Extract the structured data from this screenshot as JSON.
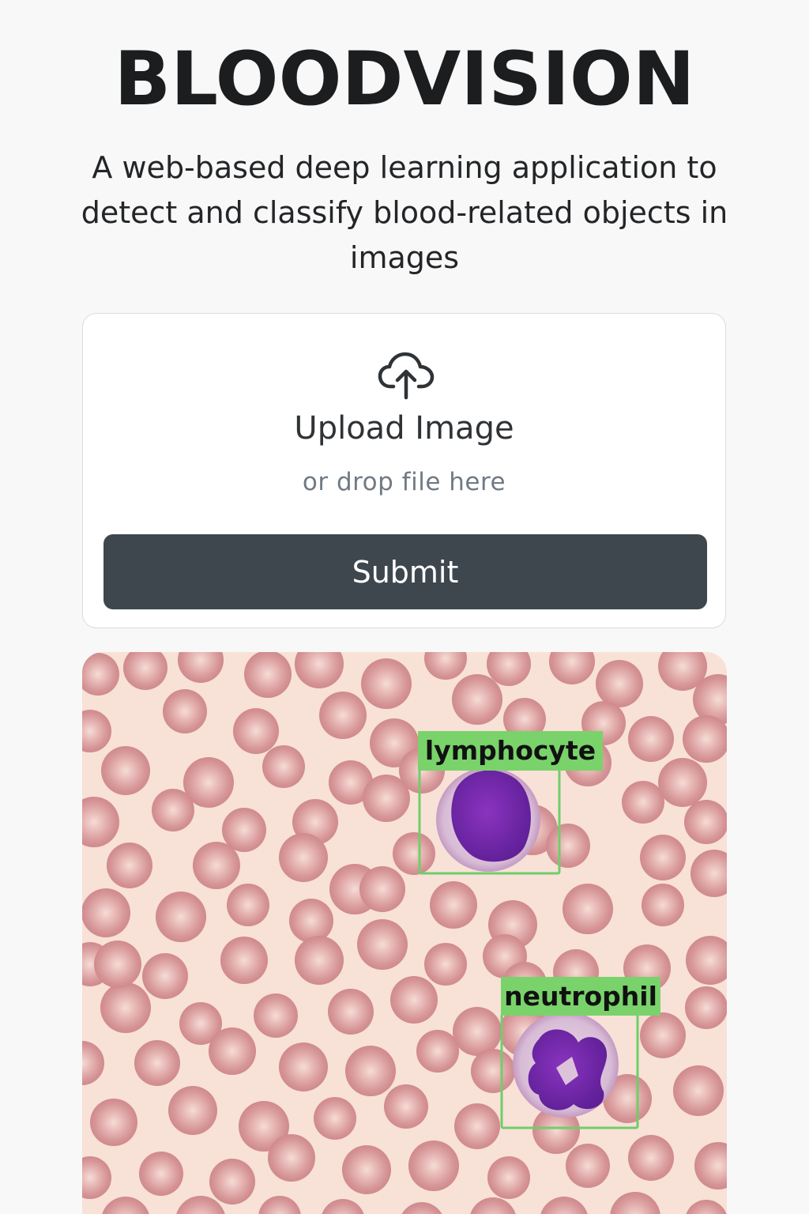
{
  "header": {
    "title": "BLOODVISION",
    "subtitle": "A web-based deep learning application to detect and classify blood-related objects in images"
  },
  "upload": {
    "icon": "cloud-upload-icon",
    "label": "Upload Image",
    "hint": "or drop file here",
    "submit_label": "Submit"
  },
  "result": {
    "detections": [
      {
        "label": "lymphocyte",
        "cell_type": "lymphocyte"
      },
      {
        "label": "neutrophil",
        "cell_type": "neutrophil"
      }
    ],
    "colors": {
      "background": "#f8e1d7",
      "red_cell": "#d99a9c",
      "box": "#6fce6a",
      "label_bg": "#79d36a",
      "nucleus": "#7a2caf"
    }
  }
}
